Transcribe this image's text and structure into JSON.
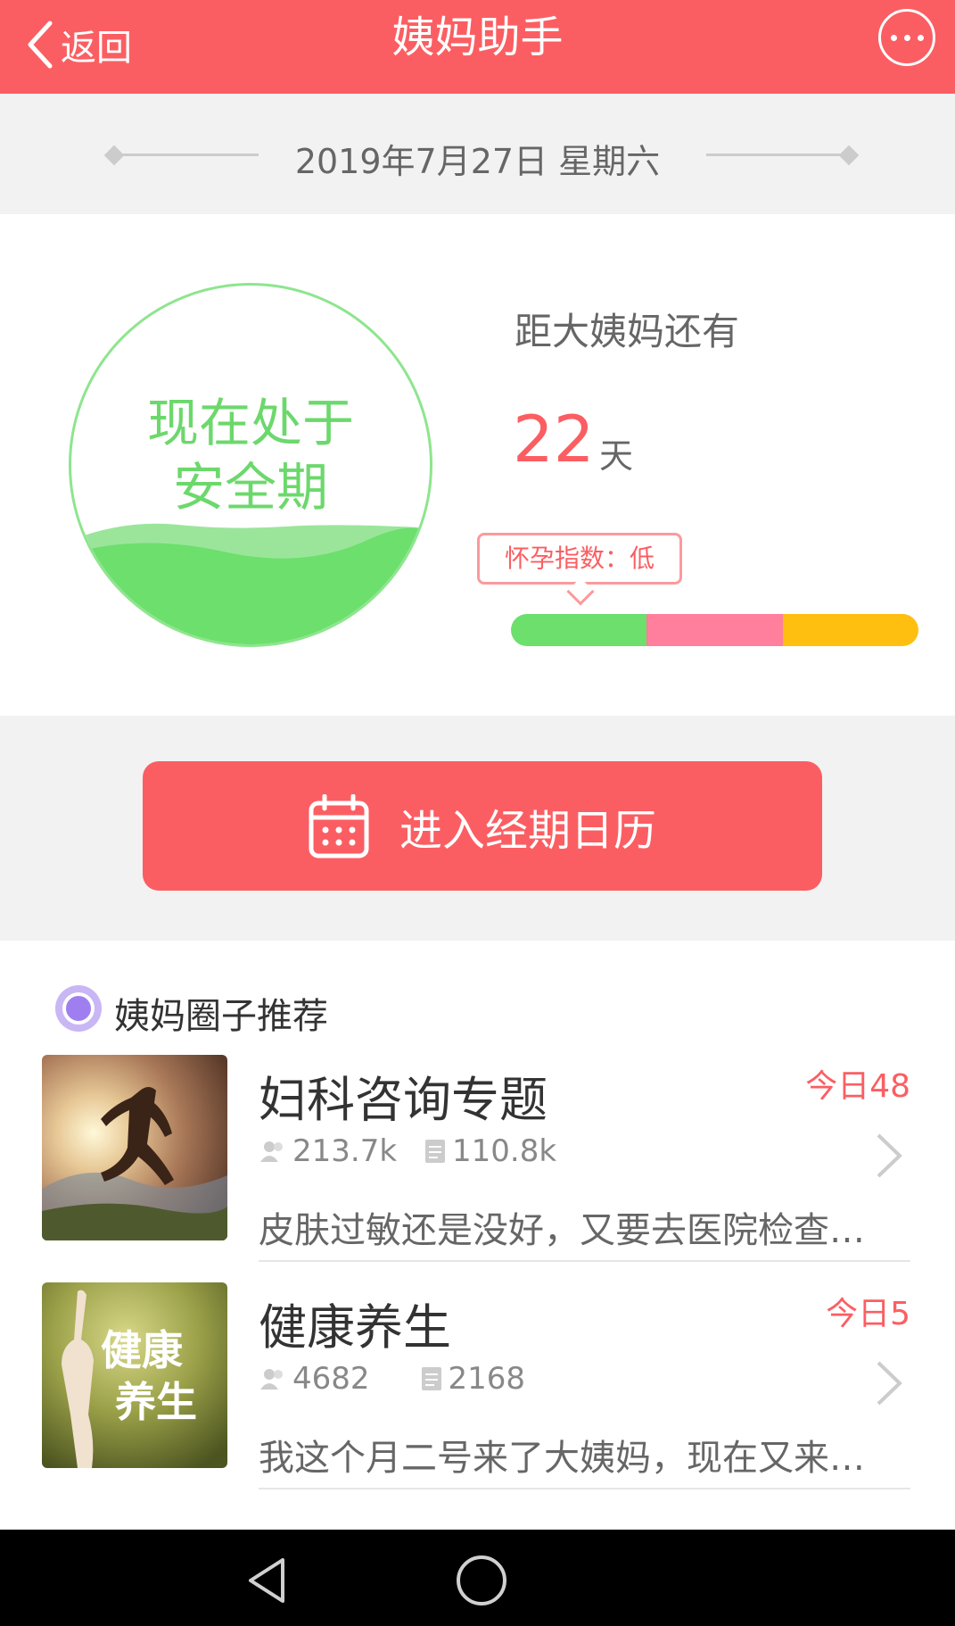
{
  "header": {
    "back_label": "返回",
    "title": "姨妈助手",
    "more_icon": "more-horizontal-icon"
  },
  "date": {
    "text": "2019年7月27日 星期六"
  },
  "status": {
    "circle_text": "现在处于安全期",
    "countdown_label": "距大姨妈还有",
    "days": "22",
    "unit": "天",
    "pregnancy_index": "怀孕指数：低",
    "index_colors": [
      "#6cdf6c",
      "#ff7f9c",
      "#ffbf10"
    ]
  },
  "calendar_button": {
    "label": "进入经期日历",
    "icon": "calendar-icon"
  },
  "circles": {
    "title": "姨妈圈子推荐",
    "items": [
      {
        "title": "妇科咨询专题",
        "badge": "今日48",
        "members": "213.7k",
        "posts": "110.8k",
        "preview": "皮肤过敏还是没好，又要去医院检查…"
      },
      {
        "title": "健康养生",
        "badge": "今日5",
        "members": "4682",
        "posts": "2168",
        "preview": "我这个月二号来了大姨妈，现在又来…",
        "thumb_text": "健康养生"
      }
    ]
  },
  "navbar": {
    "back": "back-triangle-icon",
    "home": "home-circle-icon"
  },
  "colors": {
    "accent": "#fb5e62",
    "safe_green": "#6cd86c"
  }
}
